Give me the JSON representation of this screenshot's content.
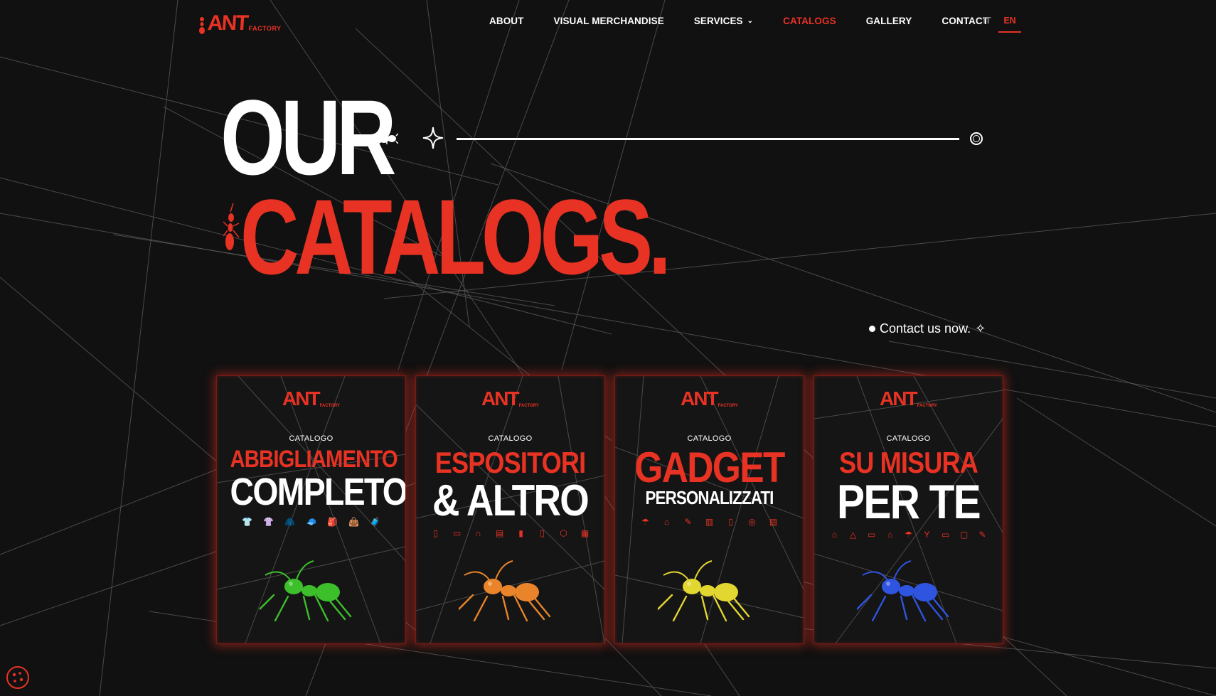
{
  "header": {
    "logo_big": "ANT",
    "logo_small": "FACTORY",
    "nav": [
      {
        "label": "ABOUT"
      },
      {
        "label": "VISUAL MERCHANDISE"
      },
      {
        "label": "SERVICES",
        "has_dropdown": true
      },
      {
        "label": "CATALOGS",
        "active": true
      },
      {
        "label": "GALLERY"
      },
      {
        "label": "CONTACT"
      }
    ],
    "lang": {
      "it": "IT",
      "en": "EN",
      "active": "EN"
    }
  },
  "hero": {
    "line1": "OUR",
    "line2": "CATALOGS.",
    "icons": [
      "beetle-icon",
      "sparkle-icon",
      "ring-icon"
    ]
  },
  "cta": {
    "label": "Contact us now.",
    "icon": "sparkle-icon"
  },
  "cards": [
    {
      "tag": "CATALOGO",
      "title1": "ABBIGLIAMENTO",
      "title2": "COMPLETO",
      "ant_color": "#3cbf2a",
      "icons": [
        "👕",
        "👚",
        "🧥",
        "🧢",
        "🎒",
        "👜",
        "🧳"
      ]
    },
    {
      "tag": "CATALOGO",
      "title1": "ESPOSITORI",
      "title2": "& ALTRO",
      "ant_color": "#e9842a",
      "icons": [
        "▯",
        "▭",
        "∩",
        "▤",
        "▮",
        "▯",
        "⬡",
        "▦"
      ]
    },
    {
      "tag": "CATALOGO",
      "title1": "GADGET",
      "title2": "PERSONALIZZATI",
      "ant_color": "#e2d630",
      "icons": [
        "☂",
        "⌂",
        "✎",
        "▥",
        "▯",
        "◎",
        "▤"
      ]
    },
    {
      "tag": "CATALOGO",
      "title1": "SU MISURA",
      "title2": "PER TE",
      "ant_color": "#2f54e0",
      "icons": [
        "⌂",
        "△",
        "▭",
        "⌂",
        "☂",
        "Y",
        "▭",
        "▢",
        "✎"
      ]
    }
  ],
  "colors": {
    "accent": "#e83223",
    "background": "#111111",
    "text": "#ffffff"
  },
  "cookie_button": "cookie-icon"
}
